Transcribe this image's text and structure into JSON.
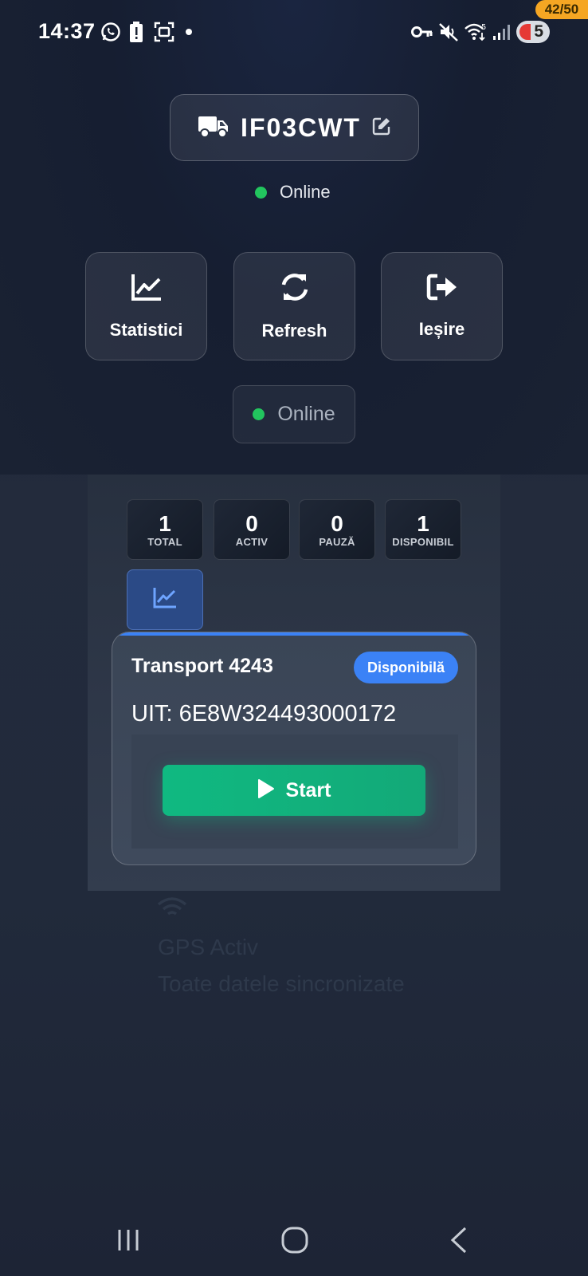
{
  "status_bar": {
    "time": "14:37",
    "left_icons": [
      "whatsapp-icon",
      "battery-alert-icon",
      "screenshot-icon",
      "dot-icon"
    ],
    "right_icons": [
      "vpn-key-icon",
      "mute-icon",
      "wifi-icon",
      "signal-icon"
    ],
    "battery_level": "5",
    "counter": "42/50"
  },
  "header": {
    "vehicle_plate": "IF03CWT",
    "status_text": "Online"
  },
  "actions": [
    {
      "label": "Statistici",
      "icon": "chart-line-icon"
    },
    {
      "label": "Refresh",
      "icon": "refresh-icon"
    },
    {
      "label": "Ieșire",
      "icon": "logout-icon"
    }
  ],
  "online_pill": {
    "label": "Online"
  },
  "stats": [
    {
      "value": "1",
      "label": "TOTAL"
    },
    {
      "value": "0",
      "label": "ACTIV"
    },
    {
      "value": "0",
      "label": "PAUZĂ"
    },
    {
      "value": "1",
      "label": "DISPONIBIL"
    }
  ],
  "transport": {
    "title": "Transport 4243",
    "badge": "Disponibilă",
    "uit_label": "UIT:",
    "uit_value": "6E8W324493000172",
    "start_label": "Start"
  },
  "background_text": {
    "gps": "GPS Activ",
    "sync": "Toate datele sincronizate"
  },
  "colors": {
    "accent_blue": "#3b82f6",
    "success_green": "#10b981",
    "online_dot": "#22c55e",
    "counter_badge": "#f5a623"
  }
}
